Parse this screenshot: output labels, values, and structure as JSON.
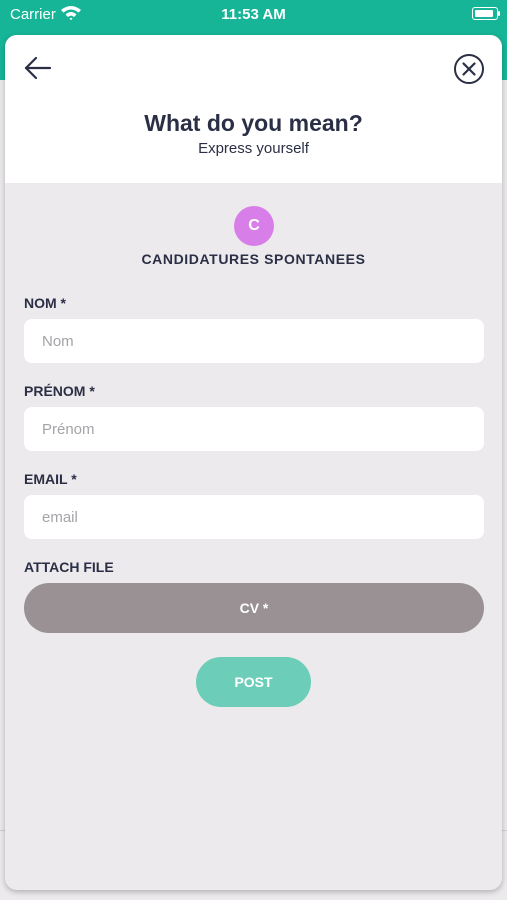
{
  "status_bar": {
    "carrier": "Carrier",
    "time": "11:53 AM",
    "battery_level": 0.9
  },
  "modal": {
    "title": "What do you mean?",
    "subtitle": "Express yourself",
    "back_icon": "arrow-left-icon",
    "close_icon": "circle-close-icon"
  },
  "category": {
    "initial": "C",
    "name": "CANDIDATURES SPONTANEES",
    "color": "#d87ee8"
  },
  "form": {
    "nom": {
      "label": "NOM *",
      "placeholder": "Nom",
      "value": ""
    },
    "prenom": {
      "label": "PRÉNOM *",
      "placeholder": "Prénom",
      "value": ""
    },
    "email": {
      "label": "EMAIL *",
      "placeholder": "email",
      "value": ""
    },
    "attach_label": "ATTACH FILE",
    "cv_button": "CV *",
    "post_button": "POST"
  },
  "colors": {
    "brand_green": "#17b597",
    "post_button": "#6ccdb9",
    "cv_button": "#9a9194",
    "text_dark": "#2b2f45"
  }
}
